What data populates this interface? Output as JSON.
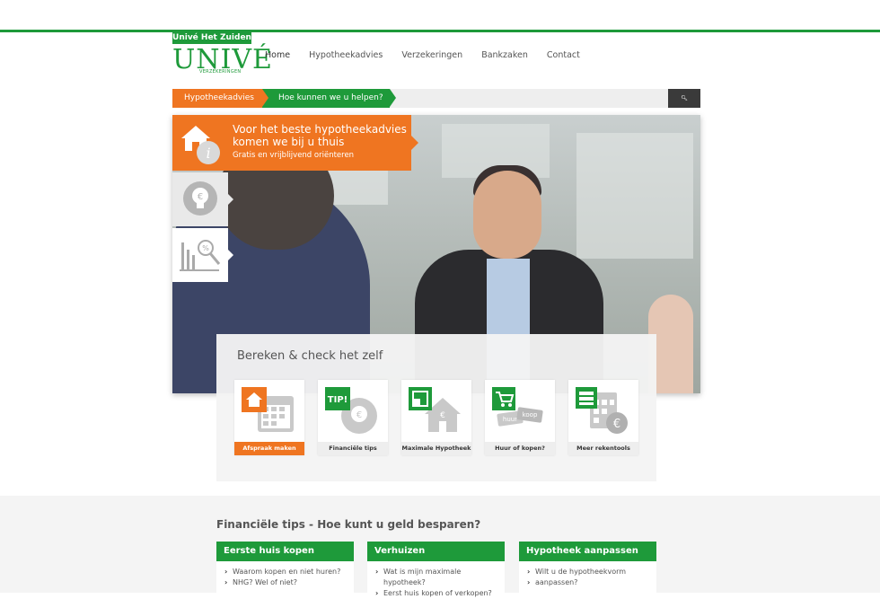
{
  "brand": {
    "tag": "Univé Het Zuiden",
    "logo_word": "UNIVÉ",
    "logo_sub": "VERZEKERINGEN",
    "color": "#1e9a3a",
    "accent": "#ef7521"
  },
  "nav": [
    "Home",
    "Hypotheekadvies",
    "Verzekeringen",
    "Bankzaken",
    "Contact"
  ],
  "searchbar": {
    "crumb1": "Hypotheekadvies",
    "crumb2": "Hoe kunnen we u helpen?",
    "button_icon": "search-icon",
    "button_glyph": "🔍︎"
  },
  "hero": {
    "promo_title": "Voor het beste hypotheekadvies komen we bij u thuis",
    "promo_sub": "Gratis en vrijblijvend oriënteren",
    "side_tabs": [
      "lightbulb-euro-icon",
      "chart-magnifier-icon"
    ]
  },
  "calc": {
    "title": "Bereken & check het zelf",
    "tools": [
      {
        "label": "Afspraak maken",
        "icon": "calendar-house-icon",
        "highlight": true
      },
      {
        "label": "Financiële tips",
        "icon": "tip-lightbulb-icon",
        "highlight": false
      },
      {
        "label": "Maximale Hypotheek",
        "icon": "house-euro-icon",
        "highlight": false
      },
      {
        "label": "Huur of kopen?",
        "icon": "cart-tags-icon",
        "highlight": false
      },
      {
        "label": "Meer rekentools",
        "icon": "calculator-euro-icon",
        "highlight": false
      }
    ]
  },
  "lower": {
    "title": "Financiële tips - Hoe kunt u geld besparen?",
    "columns": [
      {
        "header": "Eerste huis kopen",
        "items": [
          "Waarom kopen en niet huren?",
          "NHG? Wel of niet?"
        ]
      },
      {
        "header": "Verhuizen",
        "items": [
          "Wat is mijn maximale hypotheek?",
          "Eerst huis kopen of verkopen?"
        ]
      },
      {
        "header": "Hypotheek aanpassen",
        "items": [
          "Wilt u de hypotheekvorm",
          "aanpassen?"
        ]
      }
    ]
  }
}
